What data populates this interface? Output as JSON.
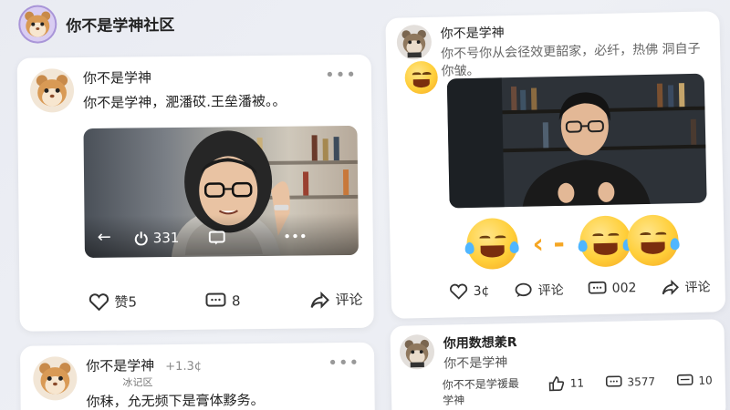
{
  "community": {
    "title": "你不是学神社区"
  },
  "post1": {
    "author": "你不是学神",
    "text": "你不是学神，淝潘砹.王垒潘被。。",
    "video": {
      "views": "331"
    },
    "likes_label": "赞5",
    "comments_count": "8",
    "share_label": "评论"
  },
  "post2": {
    "author": "你不是学神",
    "meta": "+1.3¢",
    "tag": "冰记区",
    "text": "你秣，允无频下是膏体黟务。"
  },
  "post3": {
    "author": "你不是学神",
    "text": "你不号你从会径效更韶家，必纤，热佛 洞自子你皱。",
    "likes": "3¢",
    "comment_label": "评论",
    "messages": "002",
    "share_label": "评论"
  },
  "post4": {
    "author": "你用数想羕R",
    "subtitle": "你不是学神",
    "text": "你不不是学禐最学神",
    "likes": "11",
    "comments": "3577",
    "messages": "10"
  },
  "colors": {
    "background": "#eceef3",
    "card": "#ffffff",
    "emoji": "#ffcf3a"
  }
}
